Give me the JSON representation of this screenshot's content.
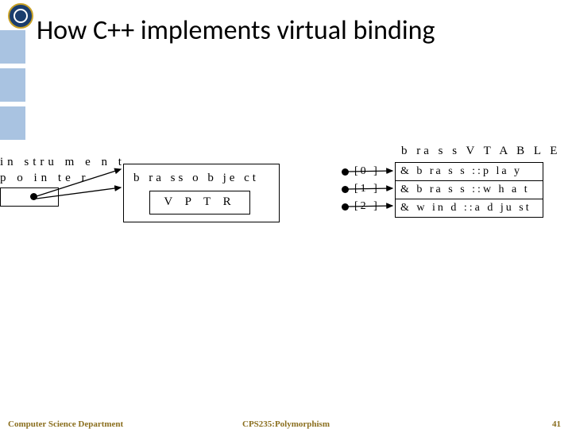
{
  "title": "How C++ implements virtual binding",
  "pointer_label_line1": "in stru m  e n t",
  "pointer_label_line2": "p o in te r",
  "brass_object_label": "b ra ss  o b je ct",
  "vptr_label": "V  P T R",
  "vtable_title": "b ra s s  V T A B L E",
  "indices": [
    "[0 ]",
    "[1 ]",
    "[2 ]"
  ],
  "vtable_rows": [
    "& b ra s s ::p la y",
    "& b ra s s ::w h a t",
    "& w in d  ::a d ju st"
  ],
  "footer_left": "Computer Science Department",
  "footer_center": "CPS235:Polymorphism",
  "footer_right": "41"
}
